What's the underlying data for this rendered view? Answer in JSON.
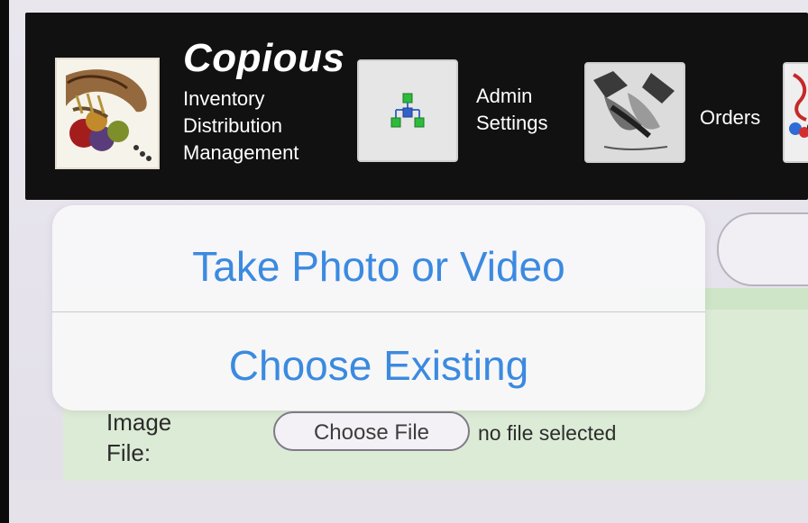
{
  "header": {
    "brand": {
      "title": "Copious",
      "subtitle_line1": "Inventory",
      "subtitle_line2": "Distribution",
      "subtitle_line3": "Management"
    },
    "nav": {
      "admin_line1": "Admin",
      "admin_line2": "Settings",
      "orders": "Orders"
    }
  },
  "popover": {
    "take_photo": "Take Photo or Video",
    "choose_existing": "Choose Existing"
  },
  "form": {
    "image_file_label_line1": "Image",
    "image_file_label_line2": "File:",
    "choose_file_button": "Choose File",
    "file_status": "no file selected"
  },
  "icons": {
    "logo": "cornucopia-logo",
    "admin_settings": "org-chart-icon",
    "orders": "handshake-icon",
    "third": "partial-icon"
  },
  "colors": {
    "accent": "#3b8ae0",
    "header_bg": "#111111",
    "form_green": "#dcebd6"
  }
}
